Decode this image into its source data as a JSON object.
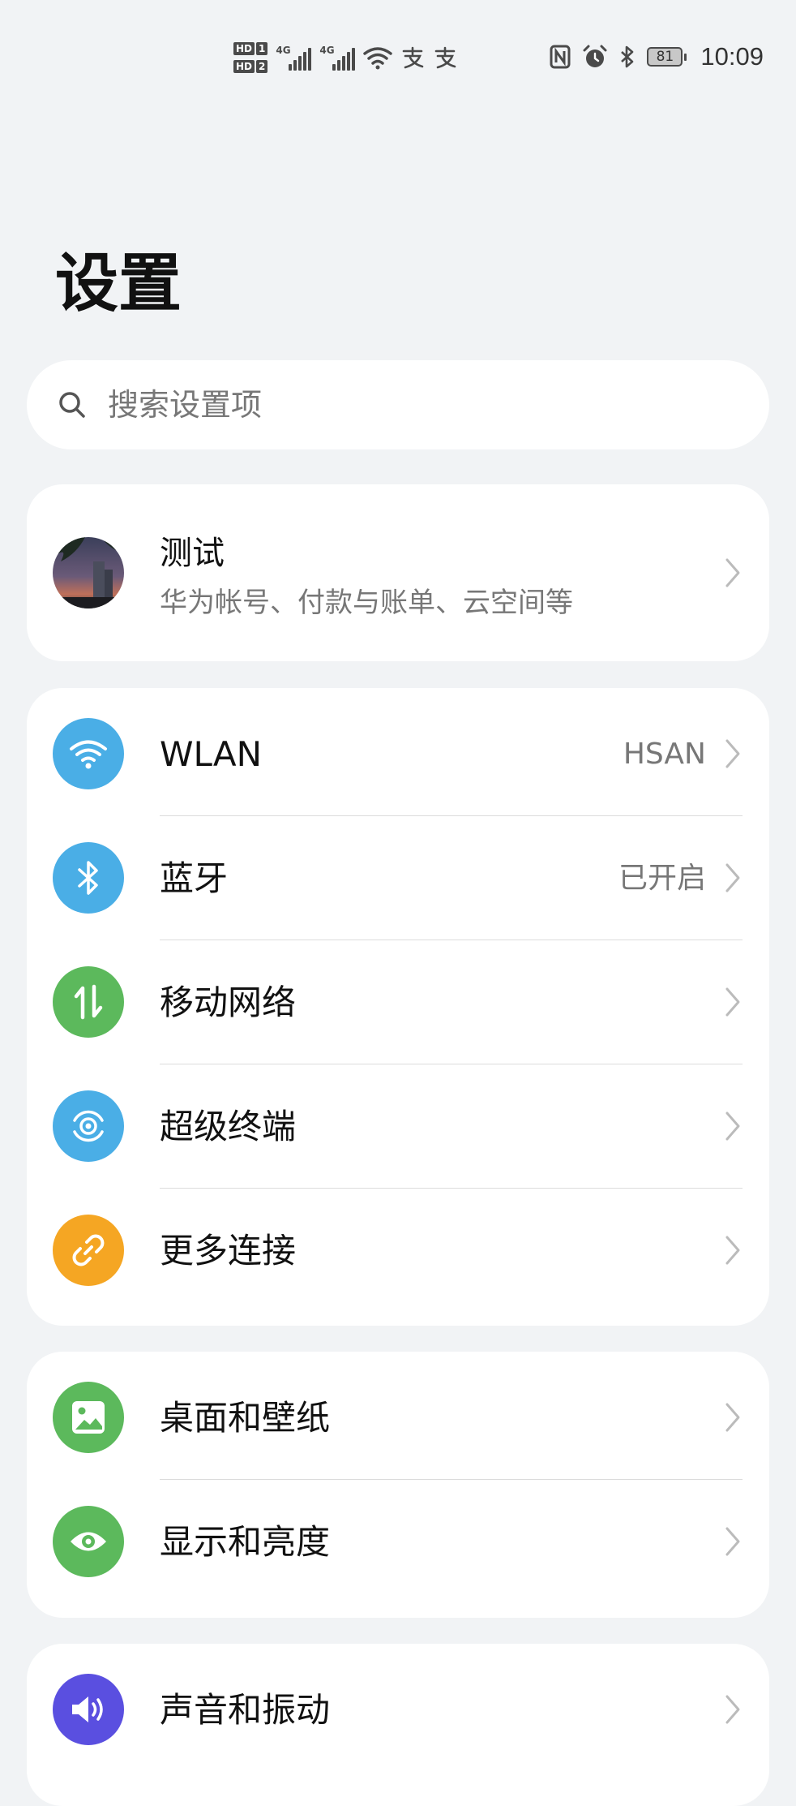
{
  "status_bar": {
    "sim1": "1",
    "sim2": "2",
    "hd": "HD",
    "net1": "4G",
    "net2": "4G",
    "time": "10:09",
    "battery": "81"
  },
  "page": {
    "title": "设置"
  },
  "search": {
    "placeholder": "搜索设置项"
  },
  "account": {
    "name": "测试",
    "subtitle": "华为帐号、付款与账单、云空间等"
  },
  "connectivity": [
    {
      "label": "WLAN",
      "value": "HSAN",
      "icon": "wifi-icon",
      "color": "#4aaee6"
    },
    {
      "label": "蓝牙",
      "value": "已开启",
      "icon": "bluetooth-icon",
      "color": "#4aaee6"
    },
    {
      "label": "移动网络",
      "value": "",
      "icon": "mobile-data-icon",
      "color": "#5cb95c"
    },
    {
      "label": "超级终端",
      "value": "",
      "icon": "super-device-icon",
      "color": "#4aaee6"
    },
    {
      "label": "更多连接",
      "value": "",
      "icon": "link-icon",
      "color": "#f5a623"
    }
  ],
  "display": [
    {
      "label": "桌面和壁纸",
      "icon": "wallpaper-icon",
      "color": "#5cb95c"
    },
    {
      "label": "显示和亮度",
      "icon": "eye-icon",
      "color": "#5cb95c"
    }
  ],
  "sound": [
    {
      "label": "声音和振动",
      "icon": "speaker-icon",
      "color": "#5a4fe0"
    }
  ]
}
